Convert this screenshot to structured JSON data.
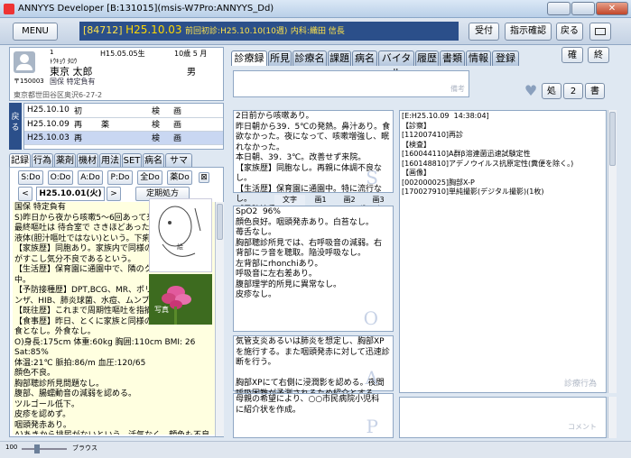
{
  "window": {
    "title": "ANNYYS Developer [B:131015](msis-W7Pro:ANNYYS_Dd)"
  },
  "header": {
    "menu": "MENU",
    "patient_id": "[84712]",
    "date": "H25.10.03",
    "prev_visit": "前回初診:H25.10.10(10週)",
    "dept": "内科:織田 信長",
    "reception": "受付",
    "instruction_confirm": "指示確認",
    "back": "戻る"
  },
  "patient": {
    "num": "1",
    "kana": "ﾄｳｷｮｳ ﾀﾛｳ",
    "name": "東京 太郎",
    "birth": "H15.05.05生",
    "age": "10歳 5 月",
    "sex": "男",
    "zip": "〒150003",
    "insurance": "国保 特定負有",
    "address": "東京都世田谷区奥沢6-27-2"
  },
  "visits": {
    "return_label": "戻る",
    "rows": [
      {
        "date": "H25.10.10",
        "type": "初",
        "c1": "",
        "c2": "検",
        "c3": "画"
      },
      {
        "date": "H25.10.09",
        "type": "再",
        "c1": "薬",
        "c2": "検",
        "c3": "画"
      },
      {
        "date": "H25.10.03",
        "type": "再",
        "c1": "",
        "c2": "検",
        "c3": "画"
      }
    ]
  },
  "left_tabs": [
    "記録",
    "行為",
    "薬剤",
    "機材",
    "用法",
    "SET",
    "病名",
    "サマリ"
  ],
  "period_buttons": [
    "S:Do",
    "O:Do",
    "A:Do",
    "P:Do",
    "全Do",
    "薬Do"
  ],
  "nav": {
    "prev": "<",
    "date": "H25.10.01(火)",
    "next": ">",
    "regular_rx": "定期処方"
  },
  "left_record": "国保 特定負有\nS)昨日から夜から咳嗽5～6回あって来院。\n最終嘔吐は 待合室で さきほどあったら。\n液体(胆汁嘔吐ではない)という。下痢な\n【家族歴】同胞あり。家族内で同様の症\nがすこし気分不良であるという。\n【生活歴】保育園に通園中で、隣のクラス\n中。\n【予防接種歴】DPT,BCG、MR、ポリオ、\nンザ、HIB、肺炎球菌、水痘、ムンプ\n【既往歴】これまで周期性嘔吐を指摘\n【食事歴】昨日、とくに家族と同様の\n食となし。外食なし。\nO)身長:175cm 体重:60kg 胸囲:110cm BMI: 26 Sat:85%\n体温:21℃ 脈拍:86/m 血圧:120/65\n顔色不良。\n胸部聴診所見問題なし。\n腹部、腸蠕動音の減弱を認める。\nツルゴール低下。\n皮疹を認めず。\n咽頭発赤あり。\nA)あきから排尿がないという。活気なく、顔色も不良で、全\n身状態はややや不良。",
  "left_labels": {
    "drawing": "絵",
    "photo": "写真"
  },
  "statusbar": {
    "zoom": "100",
    "font": "ブラウス"
  },
  "record_tabs": [
    "診療録",
    "所見",
    "診療名",
    "課題",
    "病名",
    "バイタル",
    "履歴",
    "書類",
    "情報",
    "登録"
  ],
  "right_top": {
    "confirm": "確",
    "end": "終",
    "memo": "備考",
    "heart": "♥",
    "rx": "処",
    "doc": "2",
    "book": "書"
  },
  "soap": {
    "S": "2日前から咳嗽あり。\n昨日朝から39．5℃の発熱。鼻汁あり。食\n欲なかった。夜になって、咳嗽増強し、眠\nれなかった。\n本日朝、39．3℃。改善せず来院。\n【家族歴】同胞なし。再親に体調不良なし。\n【生活歴】保育園に通園中。特に流行な\nし。\n【予防接種歴】DPT,BCG、MR、ポリオ、",
    "O_tabs": [
      "文字",
      "画1",
      "画2",
      "画3"
    ],
    "O": "SpO2  96%\n顔色良好。咽頭発赤あり。白苔なし。\n苺舌なし。\n胸部聴診所見では、右呼吸音の減弱。右\n背部にラ音を聴取。陥没呼吸なし。\n左背部にrhonchiあり。\n呼吸音に左右差あり。\n腹部理学的所見に異常なし。\n皮疹なし。",
    "A": "気管支炎あるいは肺炎を想定し、胸部XP\nを施行する。また咽頭発赤に対して迅速診\n断を行う。\n\n胸部XPにて右側に浸潤影を認める。夜間\n呼吸困難が予測されるため紹介とする",
    "P": "母親の希望により、○○市民病院小児科\nに紹介状を作成。",
    "watermarks": {
      "S": "S",
      "O": "O",
      "A": "A",
      "P": "P"
    }
  },
  "orders": "[E:H25.10.09  14:38:04]\n【診察】\n[112007410]再診\n【検査】\n[160044110]A群β溶連菌迅速試験定性\n[160148810]アデノウイルス抗原定性(糞便を除く。)\n【画像】\n[002000025]胸部X-P\n[170027910]単純撮影(デジタル撮影)(1枚)",
  "right_labels": {
    "treatment": "診療行為",
    "comment": "コメント"
  }
}
